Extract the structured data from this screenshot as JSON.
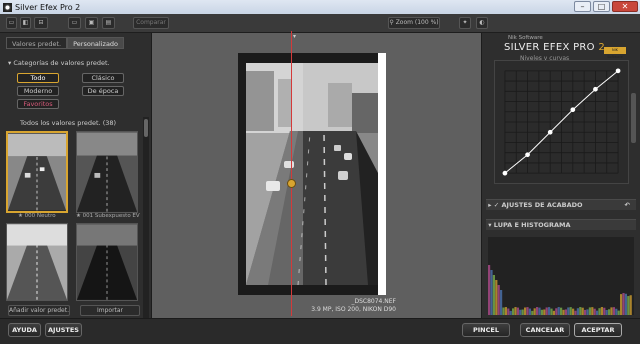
{
  "window": {
    "title": "Silver Efex Pro 2",
    "controls": [
      "minimize",
      "maximize",
      "close"
    ]
  },
  "toolbar": {
    "compare_label": "Comparar",
    "zoom_label": "Zoom (100 %)"
  },
  "left_panel": {
    "tabs": [
      {
        "label": "Valores predet.",
        "active": false
      },
      {
        "label": "Personalizado",
        "active": true
      }
    ],
    "categories_title": "Categorías de valores predet.",
    "categories": [
      "Todo",
      "Clásico",
      "Moderno",
      "De época",
      "Favoritos"
    ],
    "all_presets_title": "Todos los valores predet. (38)",
    "presets": [
      {
        "label": "★ 000 Neutro",
        "selected": true
      },
      {
        "label": "★ 001 Subexpuesto EV",
        "selected": false
      },
      {
        "label": "",
        "selected": false
      },
      {
        "label": "",
        "selected": false
      }
    ],
    "add_preset_label": "Añadir valor predet.",
    "import_label": "Importar"
  },
  "canvas": {
    "filename": "_DSC8074.NEF",
    "info": "3.9 MP, ISO 200, NIKON D90"
  },
  "right_panel": {
    "brand_small": "Nik Software",
    "brand_title": "SILVER EFEX PRO",
    "brand_version": "2",
    "badge": "NIK Software",
    "curve_header": "Niveles y curvas",
    "sections": [
      "AJUSTES DE ACABADO",
      "LUPA E HISTOGRAMA"
    ],
    "curve_points": [
      [
        0.0,
        0.0
      ],
      [
        0.2,
        0.18
      ],
      [
        0.4,
        0.4
      ],
      [
        0.6,
        0.62
      ],
      [
        0.8,
        0.82
      ],
      [
        1.0,
        1.0
      ]
    ]
  },
  "bottom_bar": {
    "help": "AYUDA",
    "settings": "AJUSTES",
    "brush": "PINCEL",
    "cancel": "CANCELAR",
    "accept": "ACEPTAR"
  },
  "colors": {
    "accent": "#d8a530",
    "split_line": "#d43a3a",
    "favorites_text": "#d75a7a"
  }
}
